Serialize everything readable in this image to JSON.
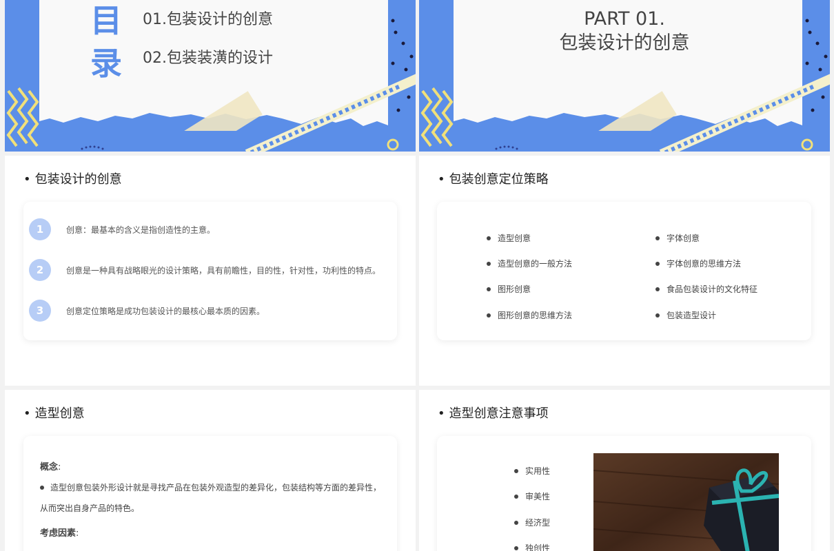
{
  "toc": {
    "char1": "目",
    "char2": "录",
    "items": [
      "01.包装设计的创意",
      "02.包装装潢的设计"
    ]
  },
  "part": {
    "line1": "PART 01.",
    "line2": "包装设计的创意"
  },
  "slide3": {
    "heading": "包装设计的创意",
    "items": [
      {
        "num": "1",
        "text": "创意：最基本的含义是指创造性的主意。"
      },
      {
        "num": "2",
        "text": "创意是一种具有战略眼光的设计策略，具有前瞻性，目的性，针对性，功利性的特点。"
      },
      {
        "num": "3",
        "text": "创意定位策略是成功包装设计的最核心最本质的因素。"
      }
    ]
  },
  "slide4": {
    "heading": "包装创意定位策略",
    "left": [
      "造型创意",
      "造型创意的一般方法",
      "图形创意",
      "图形创意的思维方法"
    ],
    "right": [
      "字体创意",
      "字体创意的思维方法",
      "食品包装设计的文化特征",
      "包装造型设计"
    ]
  },
  "slide5": {
    "heading": "造型创意",
    "concept_label": "概念",
    "concept_colon": ":",
    "concept_text": "造型创意包装外形设计就是寻找产品在包装外观造型的差异化，包装结构等方面的差异性，从而突出自身产品的特色。",
    "factor_label": "考虑因素",
    "factor_colon": ":"
  },
  "slide6": {
    "heading": "造型创意注意事项",
    "items": [
      "实用性",
      "审美性",
      "经济型",
      "独创性"
    ]
  },
  "colors": {
    "accent": "#5b8ee8",
    "yellow": "#f1e07a",
    "badge": "#b7cdf6"
  }
}
